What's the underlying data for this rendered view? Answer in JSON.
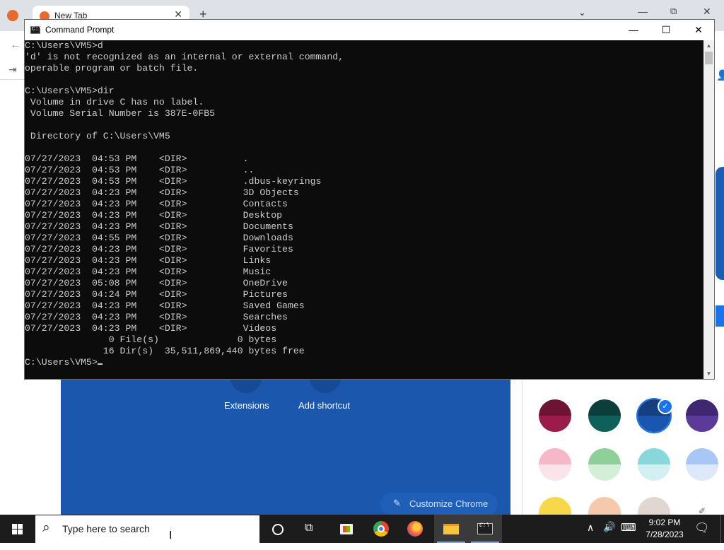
{
  "browser": {
    "tab_title": "New Tab",
    "tab_close": "✕",
    "new_tab": "+",
    "tab_search": "⌄",
    "win_min": "—",
    "win_max": "⧉",
    "win_close": "✕",
    "shortcuts": [
      {
        "label": "Extensions"
      },
      {
        "label": "Add shortcut"
      }
    ],
    "customize_label": "Customize Chrome",
    "swatch_colors": [
      "#9b1b4b",
      "#0f5f5a",
      "#1a56b0",
      "#5b3a9a",
      "#f6b8c9",
      "#8fd09a",
      "#8ad7db",
      "#a9c7f4",
      "#f7d84a",
      "#f6c9ad",
      "#e2d6d3"
    ]
  },
  "cmd": {
    "title": "Command Prompt",
    "min": "—",
    "max": "☐",
    "close": "✕",
    "output": "C:\\Users\\VM5>d\n'd' is not recognized as an internal or external command,\noperable program or batch file.\n\nC:\\Users\\VM5>dir\n Volume in drive C has no label.\n Volume Serial Number is 387E-0FB5\n\n Directory of C:\\Users\\VM5\n\n07/27/2023  04:53 PM    <DIR>          .\n07/27/2023  04:53 PM    <DIR>          ..\n07/27/2023  04:53 PM    <DIR>          .dbus-keyrings\n07/27/2023  04:23 PM    <DIR>          3D Objects\n07/27/2023  04:23 PM    <DIR>          Contacts\n07/27/2023  04:23 PM    <DIR>          Desktop\n07/27/2023  04:23 PM    <DIR>          Documents\n07/27/2023  04:55 PM    <DIR>          Downloads\n07/27/2023  04:23 PM    <DIR>          Favorites\n07/27/2023  04:23 PM    <DIR>          Links\n07/27/2023  04:23 PM    <DIR>          Music\n07/27/2023  05:08 PM    <DIR>          OneDrive\n07/27/2023  04:24 PM    <DIR>          Pictures\n07/27/2023  04:23 PM    <DIR>          Saved Games\n07/27/2023  04:23 PM    <DIR>          Searches\n07/27/2023  04:23 PM    <DIR>          Videos\n               0 File(s)              0 bytes\n              16 Dir(s)  35,511,869,440 bytes free\n",
    "prompt": "C:\\Users\\VM5>"
  },
  "taskbar": {
    "search_placeholder": "Type here to search",
    "time": "9:02 PM",
    "date": "7/28/2023"
  }
}
